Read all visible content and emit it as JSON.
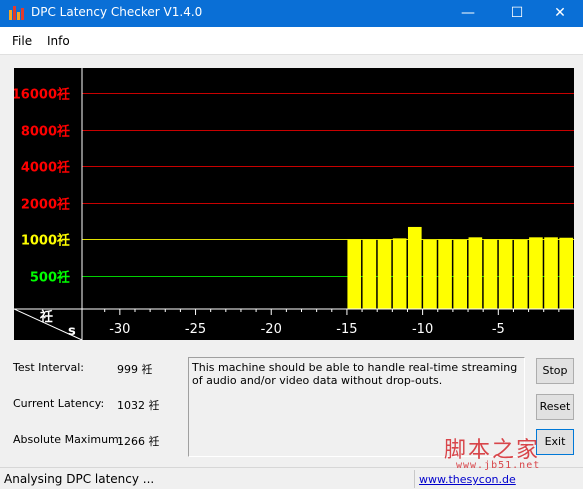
{
  "window": {
    "title": "DPC Latency Checker V1.4.0",
    "minimize": "—",
    "maximize": "☐",
    "close": "✕"
  },
  "menu": {
    "file": "File",
    "info": "Info"
  },
  "chart_data": {
    "type": "bar",
    "ylabels": [
      {
        "text": "16000祍",
        "value": 16000,
        "color": "#ff0000"
      },
      {
        "text": "8000祍",
        "value": 8000,
        "color": "#ff0000"
      },
      {
        "text": "4000祍",
        "value": 4000,
        "color": "#ff0000"
      },
      {
        "text": "2000祍",
        "value": 2000,
        "color": "#ff0000"
      },
      {
        "text": "1000祍",
        "value": 1000,
        "color": "#ffff00"
      },
      {
        "text": "500祍",
        "value": 500,
        "color": "#00ff00"
      }
    ],
    "corner_unit_y": "祍",
    "corner_unit_x": "s",
    "xticks": [
      "-30",
      "-25",
      "-20",
      "-15",
      "-10",
      "-5"
    ],
    "xtick_values": [
      -30,
      -25,
      -20,
      -15,
      -10,
      -5
    ],
    "xlim": [
      -32.5,
      0
    ],
    "bar_color": "#ffff00",
    "x": [
      -15,
      -14,
      -13,
      -12,
      -11,
      -10,
      -9,
      -8,
      -7,
      -6,
      -5,
      -4,
      -3,
      -2,
      -1
    ],
    "values": [
      1000,
      1000,
      1000,
      1020,
      1266,
      990,
      1000,
      990,
      1040,
      1000,
      1000,
      990,
      1040,
      1040,
      1032
    ]
  },
  "stats": {
    "interval_label": "Test Interval:",
    "interval_value": "999 祍",
    "current_label": "Current Latency:",
    "current_value": "1032 祍",
    "max_label": "Absolute Maximum:",
    "max_value": "1266 祍"
  },
  "message": "This machine should be able to handle real-time streaming of audio and/or video data without drop-outs.",
  "buttons": {
    "stop": "Stop",
    "reset": "Reset",
    "exit": "Exit"
  },
  "status": {
    "text": "Analysing DPC latency ...",
    "link": "www.thesycon.de"
  },
  "watermark": {
    "text": "脚本之家",
    "url": "www.jb51.net"
  }
}
